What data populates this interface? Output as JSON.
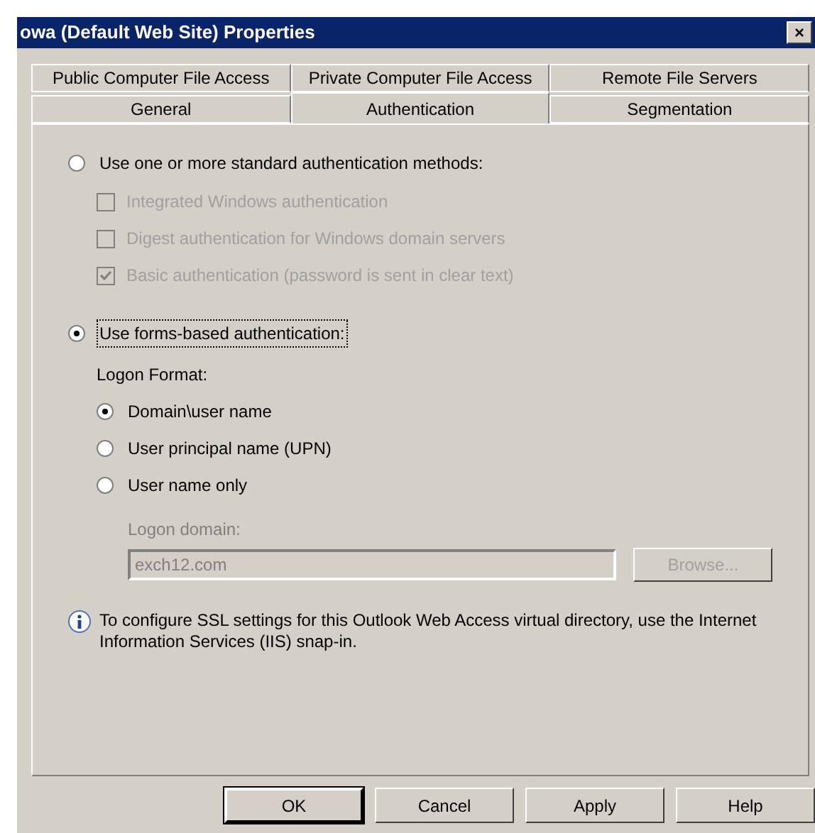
{
  "window": {
    "title": "owa (Default Web Site) Properties",
    "close": "×"
  },
  "tab_rows": [
    [
      {
        "label": "Public Computer File Access",
        "selected": false
      },
      {
        "label": "Private Computer File Access",
        "selected": false
      },
      {
        "label": "Remote File Servers",
        "selected": false
      }
    ],
    [
      {
        "label": "General",
        "selected": false
      },
      {
        "label": "Authentication",
        "selected": true
      },
      {
        "label": "Segmentation",
        "selected": false
      }
    ]
  ],
  "standard_option": {
    "label": "Use one or more standard authentication methods:",
    "selected": false
  },
  "methods": [
    {
      "label": "Integrated Windows authentication",
      "checked": false,
      "disabled": true
    },
    {
      "label": "Digest authentication for Windows domain servers",
      "checked": false,
      "disabled": true
    },
    {
      "label": "Basic authentication (password is sent in clear text)",
      "checked": true,
      "disabled": true
    }
  ],
  "forms_option": {
    "label": "Use forms-based authentication:",
    "selected": true
  },
  "logon_format": {
    "label": "Logon Format:",
    "options": [
      {
        "label": "Domain\\user name",
        "selected": true
      },
      {
        "label": "User principal name (UPN)",
        "selected": false
      },
      {
        "label": "User name only",
        "selected": false
      }
    ]
  },
  "logon_domain": {
    "label": "Logon domain:",
    "value": "exch12.com",
    "disabled": true
  },
  "browse_button": {
    "label": "Browse...",
    "disabled": true
  },
  "info": "To configure SSL settings for this Outlook Web Access virtual directory, use the Internet Information Services (IIS) snap-in.",
  "buttons": [
    {
      "label": "OK",
      "default": true
    },
    {
      "label": "Cancel",
      "default": false
    },
    {
      "label": "Apply",
      "default": false
    },
    {
      "label": "Help",
      "default": false
    }
  ]
}
